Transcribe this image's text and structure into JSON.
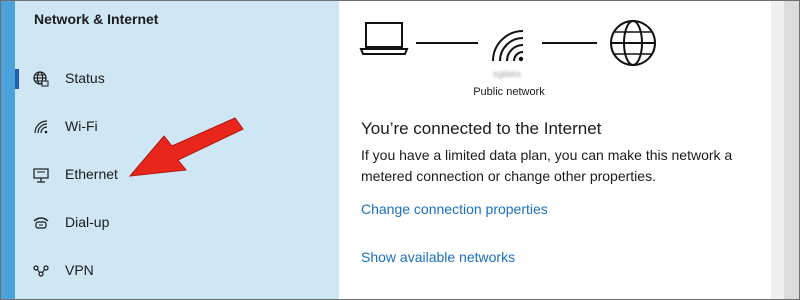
{
  "sidebar": {
    "title": "Network & Internet",
    "items": [
      {
        "label": "Status",
        "icon": "globe-icon",
        "selected": true
      },
      {
        "label": "Wi-Fi",
        "icon": "wifi-icon",
        "selected": false
      },
      {
        "label": "Ethernet",
        "icon": "ethernet-icon",
        "selected": false
      },
      {
        "label": "Dial-up",
        "icon": "dialup-icon",
        "selected": false
      },
      {
        "label": "VPN",
        "icon": "vpn-icon",
        "selected": false
      }
    ]
  },
  "main": {
    "network_name": "ogileks",
    "network_type": "Public network",
    "status_heading": "You’re connected to the Internet",
    "status_description": "If you have a limited data plan, you can make this network a metered connection or change other properties.",
    "links": {
      "change_properties": "Change connection properties",
      "show_networks": "Show available networks"
    }
  },
  "colors": {
    "sidebar_bg": "#cfe6f4",
    "accent_edge": "#4aa1dc",
    "selection_bar": "#1f5fae",
    "link": "#1a6fc2",
    "arrow": "#e8261b"
  }
}
